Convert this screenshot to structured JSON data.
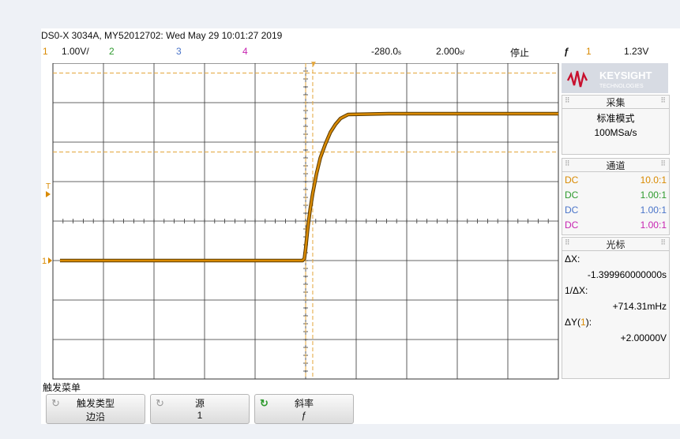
{
  "header": {
    "title": "DS0-X 3034A, MY52012702: Wed May 29 10:01:27 2019",
    "channels": [
      {
        "num": "1",
        "scale": "1.00V/",
        "color": "#d98a00"
      },
      {
        "num": "2",
        "scale": "",
        "color": "#2e9a2e"
      },
      {
        "num": "3",
        "scale": "",
        "color": "#4a74c9"
      },
      {
        "num": "4",
        "scale": "",
        "color": "#c724b1"
      }
    ],
    "time_offset": "-280.0",
    "time_offset_unit": "s",
    "time_scale": "2.000",
    "time_scale_unit": "s/",
    "run_state": "停止",
    "trigger_slope_icon": "rising-edge-icon",
    "trigger_slope_glyph": "ƒ",
    "trigger_channel": "1",
    "trigger_level": "1.23V"
  },
  "brand": {
    "name": "KEYSIGHT",
    "sub": "TECHNOLOGIES",
    "color": "#c8102e"
  },
  "acquire": {
    "heading": "采集",
    "mode": "标准模式",
    "rate": "100MSa/s"
  },
  "channels_panel": {
    "heading": "通道",
    "rows": [
      {
        "coupling": "DC",
        "probe": "10.0:1",
        "color": "#d98a00"
      },
      {
        "coupling": "DC",
        "probe": "1.00:1",
        "color": "#2e9a2e"
      },
      {
        "coupling": "DC",
        "probe": "1.00:1",
        "color": "#4a74c9"
      },
      {
        "coupling": "DC",
        "probe": "1.00:1",
        "color": "#c724b1"
      }
    ]
  },
  "cursors": {
    "heading": "光标",
    "dx_label": "ΔX:",
    "dx_value": "-1.399960000000s",
    "inv_dx_label": "1/ΔX:",
    "inv_dx_value": "+714.31mHz",
    "dy_label_prefix": "ΔY(",
    "dy_label_channel": "1",
    "dy_label_suffix": "):",
    "dy_value": "+2.00000V"
  },
  "softkeys": {
    "menu_title": "触发菜单",
    "keys": [
      {
        "label": "触发类型",
        "value": "边沿"
      },
      {
        "label": "源",
        "value": "1"
      },
      {
        "label": "斜率",
        "value": "ƒ"
      }
    ]
  },
  "markers": {
    "ch1_ground": "1",
    "trigger_level_marker": "T"
  },
  "colors": {
    "trace": "#d98a00",
    "trace_dark": "#5a3a00",
    "grid": "#333333",
    "cursor": "#e3a53a"
  },
  "chart_data": {
    "type": "line",
    "title": "",
    "xlabel": "",
    "ylabel": "",
    "x_unit": "s",
    "y_unit": "V",
    "xlim": [
      -10.28,
      9.72
    ],
    "ylim": [
      -4,
      4
    ],
    "grid": true,
    "series": [
      {
        "name": "1",
        "x": [
          -10.0,
          -6.0,
          -2.0,
          -0.4,
          -0.33,
          -0.28,
          -0.2,
          -0.1,
          0.0,
          0.15,
          0.3,
          0.5,
          0.7,
          0.9,
          1.1,
          1.4,
          3.0,
          6.0,
          9.72
        ],
        "y": [
          -1.0,
          -1.0,
          -1.0,
          -1.0,
          -0.95,
          -0.7,
          -0.2,
          0.3,
          0.7,
          1.2,
          1.6,
          1.95,
          2.25,
          2.45,
          2.6,
          2.7,
          2.72,
          2.72,
          2.72
        ]
      }
    ],
    "cursors": {
      "x1": -0.28,
      "x2": 0.0,
      "y1": 3.75,
      "y2": 1.75
    }
  }
}
